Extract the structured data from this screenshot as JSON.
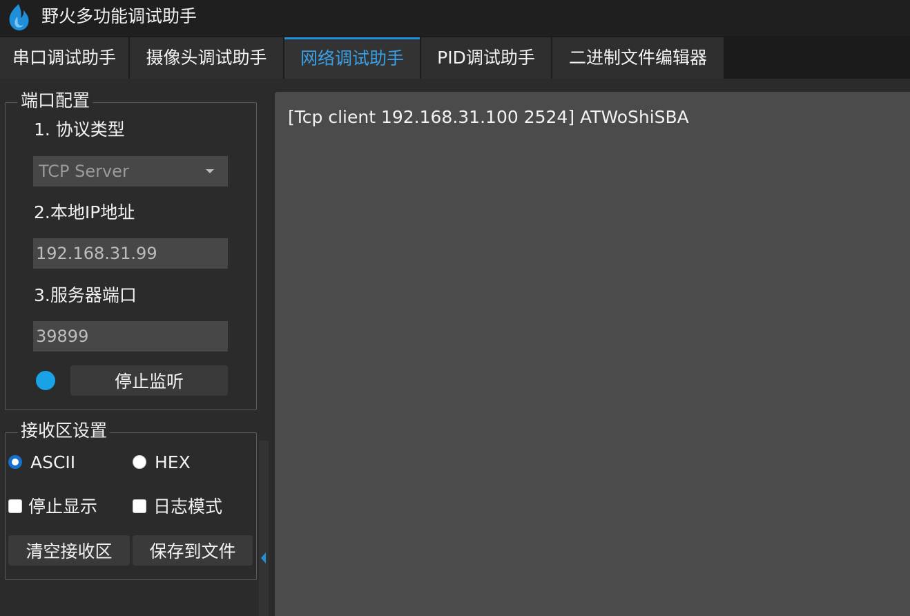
{
  "app": {
    "title": "野火多功能调试助手",
    "icon": "flame-logo-icon",
    "accent_color": "#1e8fd8"
  },
  "tabs": [
    {
      "label": "串口调试助手",
      "active": false
    },
    {
      "label": "摄像头调试助手",
      "active": false
    },
    {
      "label": "网络调试助手",
      "active": true
    },
    {
      "label": "PID调试助手",
      "active": false
    },
    {
      "label": "二进制文件编辑器",
      "active": false
    }
  ],
  "port_config": {
    "title": "端口配置",
    "protocol_label": "1. 协议类型",
    "protocol_value": "TCP Server",
    "local_ip_label": "2.本地IP地址",
    "local_ip_value": "192.168.31.99",
    "server_port_label": "3.服务器端口",
    "server_port_value": "39899",
    "status_color": "#1aa2e6",
    "stop_listen_label": "停止监听"
  },
  "receive_settings": {
    "title": "接收区设置",
    "ascii_label": "ASCII",
    "ascii_checked": true,
    "hex_label": "HEX",
    "hex_checked": false,
    "stop_display_label": "停止显示",
    "log_mode_label": "日志模式",
    "clear_label": "清空接收区",
    "save_label": "保存到文件"
  },
  "receive_area": {
    "text": "[Tcp client 192.168.31.100 2524] ATWoShiSBA"
  }
}
